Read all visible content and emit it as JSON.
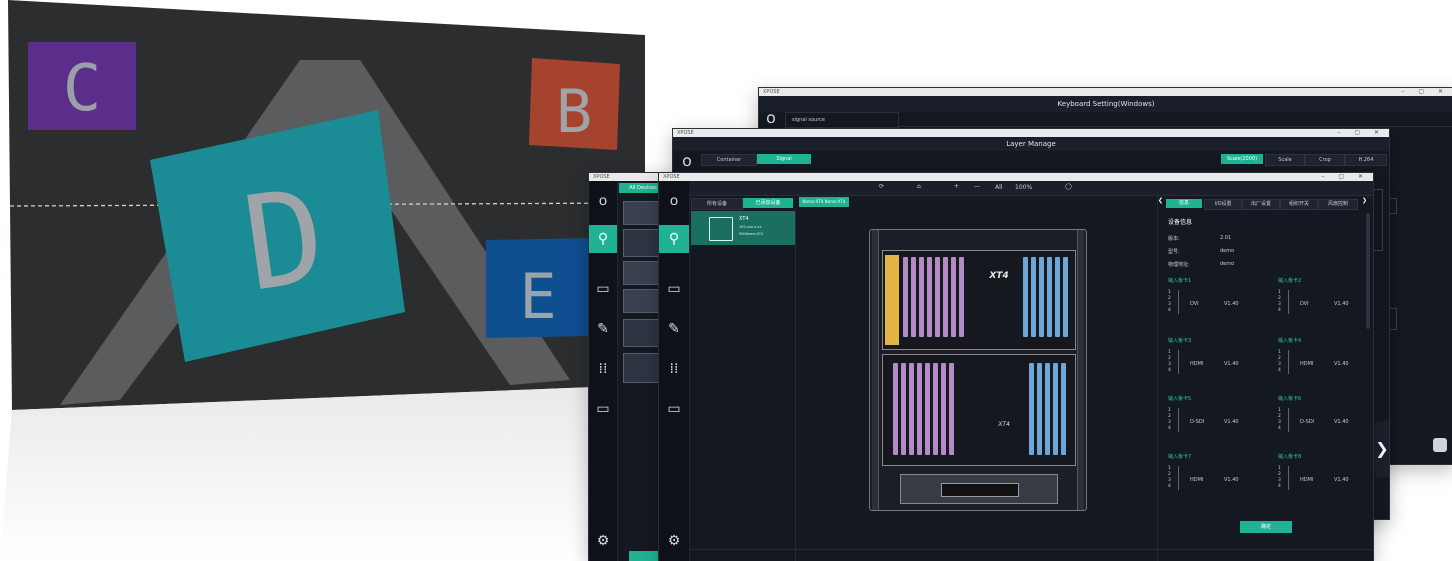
{
  "led_wall": {
    "letters": [
      {
        "label": "C",
        "color": "#5c2f8c"
      },
      {
        "label": "B",
        "color": "#a8432d"
      },
      {
        "label": "D",
        "color": "#1a8a93"
      },
      {
        "label": "E",
        "color": "#0d4f8f"
      }
    ],
    "background": "#2a2b2c"
  },
  "window_back": {
    "app_name": "XPOSE",
    "title": "Keyboard Setting(Windows)",
    "sidebar_label": "signal source",
    "controls": "–  ▢  ✕"
  },
  "window_mid": {
    "app_name": "XPOSE",
    "title": "Layer Manage",
    "tabs": [
      "Container",
      "Signal"
    ],
    "right_tabs": [
      "Scale(2000)",
      "Scale",
      "Crop",
      "H.264"
    ],
    "controls": "–  ▢  ✕"
  },
  "window_front": {
    "app_name": "XPOSE",
    "left_app_name": "XPOSE",
    "left_header": "All Devices",
    "controls": "–  ▢  ✕",
    "toolbar": {
      "all_label": "All",
      "zoom": "100%",
      "minus": "—",
      "plus": "+"
    },
    "device_tabs": [
      "所有设备",
      "已添加设备"
    ],
    "device_tag": "Name:XT4 Name:XT4",
    "device": {
      "name": "XT4",
      "line1": "192.xxx.x.xx",
      "line2": "SN:Name:XT4"
    },
    "rack": {
      "brand_top": "XT4",
      "brand_mid": "XT4"
    },
    "right_tabs": [
      "信息",
      "I/O设置",
      "出厂设置",
      "组织开关",
      "风扇控制"
    ],
    "info_title": "设备信息",
    "info": [
      {
        "k": "版本:",
        "v": "2.01"
      },
      {
        "k": "型号:",
        "v": "demo"
      },
      {
        "k": "物理地址:",
        "v": "demo"
      }
    ],
    "input_cards": [
      {
        "name": "输入板卡1",
        "type": "DVI",
        "ver": "V1.40"
      },
      {
        "name": "输入板卡2",
        "type": "DVI",
        "ver": "V1.40"
      },
      {
        "name": "输入板卡3",
        "type": "HDMI",
        "ver": "V1.40"
      },
      {
        "name": "输入板卡4",
        "type": "HDMI",
        "ver": "V1.40"
      },
      {
        "name": "输入板卡5",
        "type": "D-SDI",
        "ver": "V1.40"
      },
      {
        "name": "输入板卡6",
        "type": "D-SDI",
        "ver": "V1.40"
      },
      {
        "name": "输入板卡7",
        "type": "HDMI",
        "ver": "V1.40"
      },
      {
        "name": "输入板卡8",
        "type": "HDMI",
        "ver": "V1.40"
      }
    ],
    "port_numbers": [
      "1",
      "2",
      "3",
      "4"
    ],
    "confirm_label": "确定"
  },
  "colors": {
    "accent": "#1fb394",
    "dark": "#141821",
    "yellow": "#e3b545",
    "purple": "#b48cc5",
    "blue": "#6ea6d6"
  },
  "icons": [
    "logo-icon",
    "search-icon",
    "monitor-icon",
    "edit-icon",
    "grid-icon",
    "device-icon",
    "settings-icon",
    "refresh-icon",
    "lock-icon",
    "chevron-right-icon"
  ]
}
